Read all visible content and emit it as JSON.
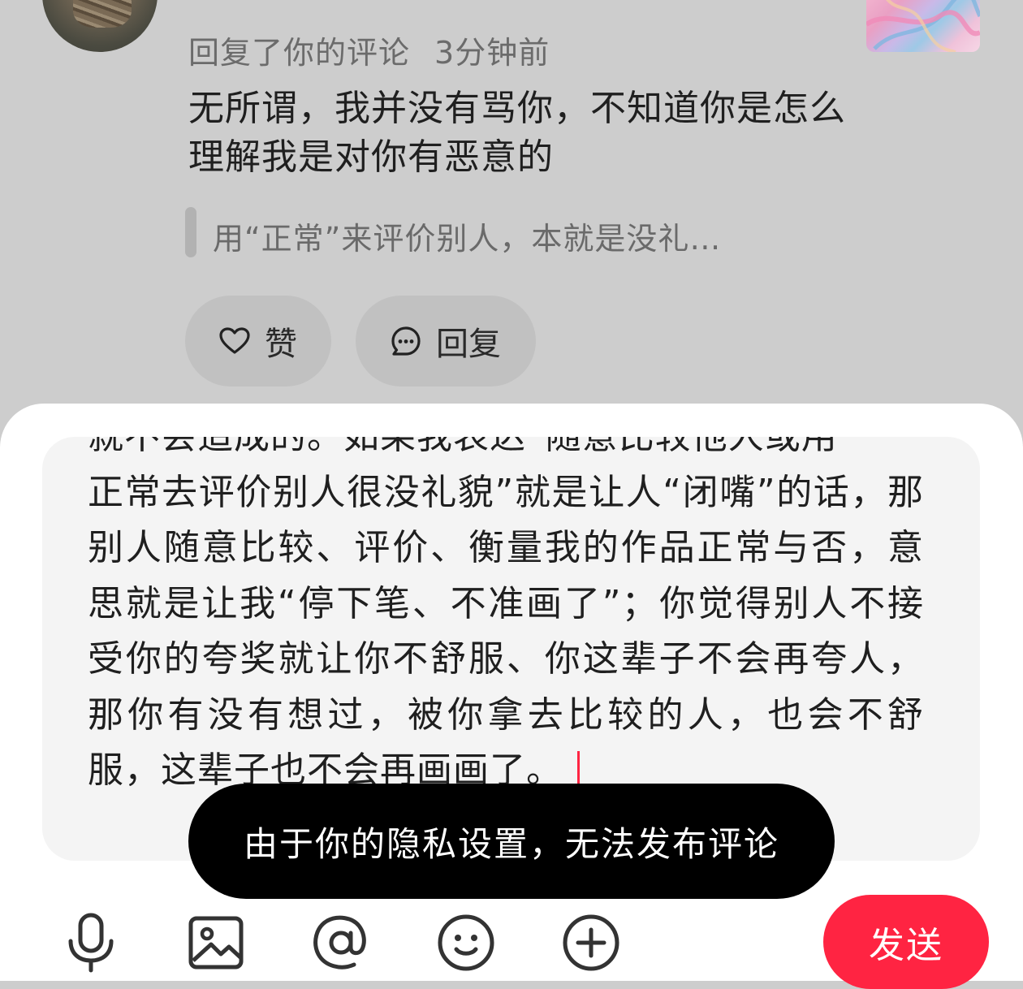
{
  "comment": {
    "meta_action": "回复了你的评论",
    "meta_time": "3分钟前",
    "text": "无所谓，我并没有骂你，不知道你是怎么理解我是对你有恶意的",
    "quote": "用“正常”来评价别人，本就是没礼…",
    "like_label": "赞",
    "reply_label": "回复"
  },
  "composer": {
    "text_partial_top": "就不会造成的。如果我表达“随意比较他人或用",
    "text": "正常去评价别人很没礼貌”就是让人“闭嘴”的话，那别人随意比较、评价、衡量我的作品正常与否，意思就是让我“停下笔、不准画了”；你觉得别人不接受你的夸奖就让你不舒服、你这辈子不会再夸人，那你有没有想过，被你拿去比较的人，也会不舒服，这辈子也不会再画画了。",
    "toast": "由于你的隐私设置，无法发布评论",
    "send_label": "发送",
    "tools": [
      "microphone-icon",
      "image-icon",
      "at-icon",
      "emoji-icon",
      "plus-icon"
    ]
  },
  "colors": {
    "accent": "#ff2442",
    "overlay_bg": "#cdcdcd",
    "toast_bg": "#000000"
  }
}
